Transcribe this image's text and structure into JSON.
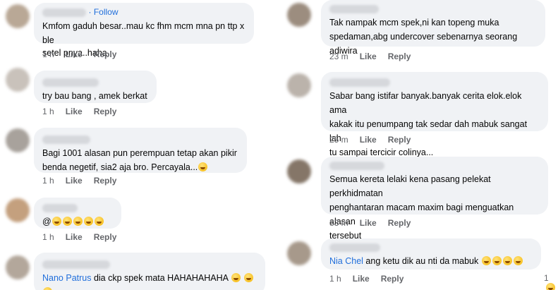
{
  "left": {
    "comments": [
      {
        "follow": "· Follow",
        "text_lines": [
          "Kmfom gaduh besar..mau kc fhm mcm mna pn ttp x ble",
          "setel pnya..haha"
        ],
        "time": "1 h",
        "like": "Like",
        "reply": "Reply"
      },
      {
        "text_lines": [
          "try bau bang , amek berkat"
        ],
        "time": "1 h",
        "like": "Like",
        "reply": "Reply"
      },
      {
        "text_lines": [
          "Bagi 1001 alasan pun perempuan tetap akan pikir",
          "benda negetif, sia2 aja bro. Percayala..."
        ],
        "time": "1 h",
        "like": "Like",
        "reply": "Reply"
      },
      {
        "text_lines": [
          "@"
        ],
        "time": "1 h",
        "like": "Like",
        "reply": "Reply"
      },
      {
        "mention": "Nano Patrus",
        "text_lines": [
          " dia ckp spek mata HAHAHAHAHA"
        ]
      }
    ]
  },
  "right": {
    "comments": [
      {
        "text_lines": [
          "Tak nampak mcm spek,ni kan topeng muka",
          "spedaman,abg undercover sebenarnya seorang adiwira"
        ],
        "time": "23 m",
        "like": "Like",
        "reply": "Reply"
      },
      {
        "text_lines": [
          "Sabar bang istifar banyak.banyak cerita elok.elok ama",
          "kakak itu penumpang tak sedar dah mabuk sangat lah",
          "tu sampai tercicir colinya..."
        ],
        "time": "25 m",
        "like": "Like",
        "reply": "Reply"
      },
      {
        "text_lines": [
          "Semua kereta lelaki kena pasang pelekat perkhidmatan",
          "penghantaran macam maxim bagi menguatkan alasan",
          "tersebut"
        ],
        "time": "33 m",
        "like": "Like",
        "reply": "Reply"
      },
      {
        "mention": "Nia Chel",
        "text_lines": [
          " ang ketu dik au nti da mabuk"
        ],
        "time": "1 h",
        "like": "Like",
        "reply": "Reply",
        "reaction_count": "1"
      }
    ]
  },
  "colors": {
    "bubble": "#f0f2f5",
    "link": "#216fdb",
    "meta": "#65676b"
  }
}
